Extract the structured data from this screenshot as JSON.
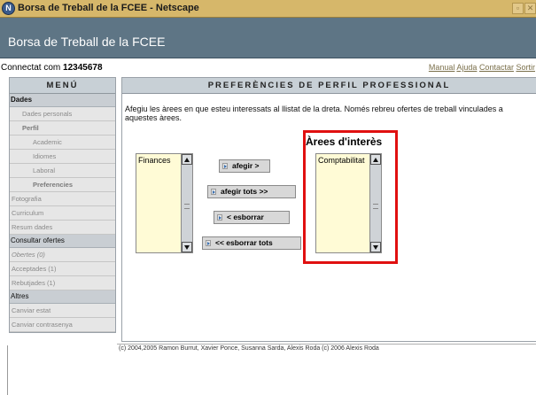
{
  "window": {
    "title": "Borsa de Treball de la FCEE - Netscape",
    "icon": "netscape-icon",
    "minimize_glyph": "▫",
    "close_glyph": "✕"
  },
  "header": {
    "title": "Borsa de Treball de la FCEE"
  },
  "status": {
    "connected_label": "Connectat com ",
    "user_id": "12345678",
    "links": [
      "Manual",
      "Ajuda",
      "Contactar",
      "Sortir"
    ]
  },
  "sidebar": {
    "heading": "MENÚ",
    "dades": "Dades",
    "dades_personals": "Dades personals",
    "perfil": "Perfil",
    "academic": "Academic",
    "idiomes": "Idiomes",
    "laboral": "Laboral",
    "preferencies": "Preferencies",
    "fotografia": "Fotografia",
    "curriculum": "Curriculum",
    "resum_dades": "Resum dades",
    "consultar_ofertes": "Consultar ofertes",
    "obertes": "Obertes (0)",
    "acceptades": "Acceptades (1)",
    "rebutjades": "Rebutjades (1)",
    "altres": "Altres",
    "canviar_estat": "Canviar estat",
    "canviar_contrasenya": "Canviar contrasenya"
  },
  "main": {
    "heading": "PREFERÈNCIES DE PERFIL PROFESSIONAL",
    "intro": "Afegiu les àrees en que esteu interessats al llistat de la dreta. Només rebreu ofertes de treball vinculades a aquestes àrees.",
    "available_list": [
      "Finances"
    ],
    "areas_title": "Àrees d'interès",
    "selected_list": [
      "Comptabilitat"
    ],
    "buttons": {
      "add": "afegir >",
      "add_all": "afegir tots >>",
      "remove": "< esborrar",
      "remove_all": "<< esborrar tots"
    },
    "highlight_color": "#e01010",
    "list_background": "#fffbd6"
  },
  "footer": {
    "text": "(c) 2004,2005 Ramon Burrut, Xavier Ponce, Susanna Sarda, Alexis Roda (c) 2006 Alexis Roda"
  }
}
